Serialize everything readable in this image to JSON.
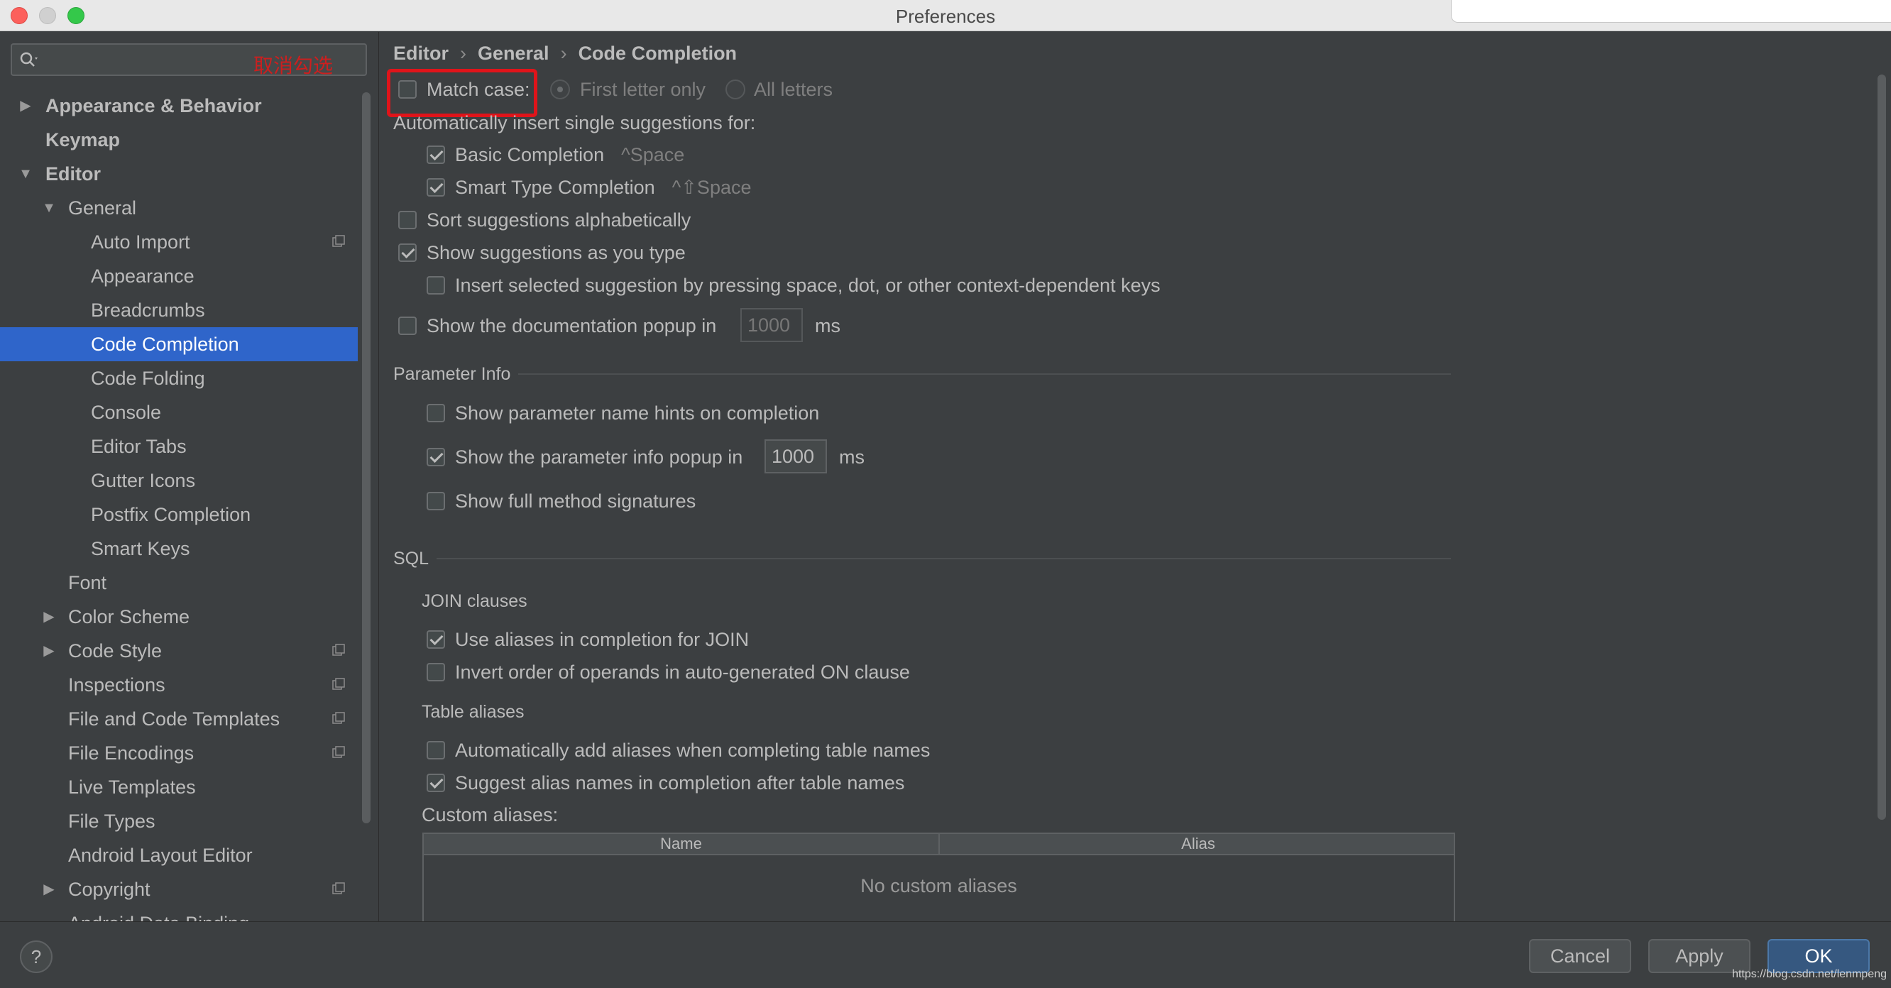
{
  "window": {
    "title": "Preferences"
  },
  "search": {
    "value": "",
    "annotation": "取消勾选"
  },
  "sidebar": {
    "items": [
      {
        "label": "Appearance & Behavior",
        "arrow": "▶"
      },
      {
        "label": "Keymap"
      },
      {
        "label": "Editor",
        "arrow": "▼"
      },
      {
        "label": "General",
        "arrow": "▼"
      },
      {
        "label": "Auto Import"
      },
      {
        "label": "Appearance"
      },
      {
        "label": "Breadcrumbs"
      },
      {
        "label": "Code Completion"
      },
      {
        "label": "Code Folding"
      },
      {
        "label": "Console"
      },
      {
        "label": "Editor Tabs"
      },
      {
        "label": "Gutter Icons"
      },
      {
        "label": "Postfix Completion"
      },
      {
        "label": "Smart Keys"
      },
      {
        "label": "Font"
      },
      {
        "label": "Color Scheme",
        "arrow": "▶"
      },
      {
        "label": "Code Style",
        "arrow": "▶"
      },
      {
        "label": "Inspections"
      },
      {
        "label": "File and Code Templates"
      },
      {
        "label": "File Encodings"
      },
      {
        "label": "Live Templates"
      },
      {
        "label": "File Types"
      },
      {
        "label": "Android Layout Editor"
      },
      {
        "label": "Copyright",
        "arrow": "▶"
      },
      {
        "label": "Android Data Binding"
      }
    ]
  },
  "breadcrumb": {
    "editor": "Editor",
    "general": "General",
    "current": "Code Completion",
    "sep": "›"
  },
  "completion": {
    "match_case": {
      "label": "Match case:",
      "checked": false
    },
    "first_letter": "First letter only",
    "all_letters": "All letters",
    "auto_insert_header": "Automatically insert single suggestions for:",
    "basic": {
      "label": "Basic Completion",
      "shortcut": "^Space",
      "checked": true
    },
    "smart": {
      "label": "Smart Type Completion",
      "shortcut": "^⇧Space",
      "checked": true
    },
    "sort_alpha": {
      "label": "Sort suggestions alphabetically",
      "checked": false
    },
    "show_as_type": {
      "label": "Show suggestions as you type",
      "checked": true
    },
    "insert_selected": {
      "label": "Insert selected suggestion by pressing space, dot, or other context-dependent keys",
      "checked": false
    },
    "doc_popup": {
      "label": "Show the documentation popup in",
      "value": "1000",
      "unit": "ms",
      "checked": false
    }
  },
  "param_info": {
    "title": "Parameter Info",
    "name_hints": {
      "label": "Show parameter name hints on completion",
      "checked": false
    },
    "info_popup": {
      "label": "Show the parameter info popup in",
      "value": "1000",
      "unit": "ms",
      "checked": true
    },
    "full_signatures": {
      "label": "Show full method signatures",
      "checked": false
    }
  },
  "sql": {
    "title": "SQL",
    "join_title": "JOIN clauses",
    "use_aliases": {
      "label": "Use aliases in completion for JOIN",
      "checked": true
    },
    "invert_order": {
      "label": "Invert order of operands in auto-generated ON clause",
      "checked": false
    },
    "table_aliases_title": "Table aliases",
    "auto_add": {
      "label": "Automatically add aliases when completing table names",
      "checked": false
    },
    "suggest_alias": {
      "label": "Suggest alias names in completion after table names",
      "checked": true
    },
    "custom_aliases_title": "Custom aliases:",
    "table": {
      "col_name": "Name",
      "col_alias": "Alias",
      "empty": "No custom aliases"
    }
  },
  "footer": {
    "help": "?",
    "cancel": "Cancel",
    "apply": "Apply",
    "ok": "OK",
    "watermark": "https://blog.csdn.net/lenmpeng"
  },
  "colors": {
    "selection": "#2f65ca",
    "highlight": "#e0141a",
    "ok_button": "#365880"
  }
}
